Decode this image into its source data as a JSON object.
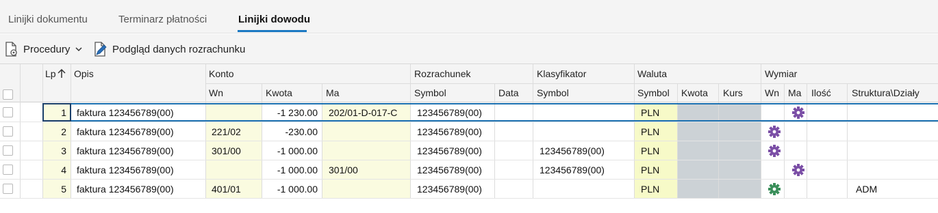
{
  "tabs": [
    {
      "label": "Linijki dokumentu"
    },
    {
      "label": "Terminarz płatności"
    },
    {
      "label": "Linijki dowodu"
    }
  ],
  "toolbar": {
    "procedures_label": "Procedury",
    "preview_label": "Podgląd danych rozrachunku"
  },
  "colors": {
    "accent": "#1a78c2",
    "gear_purple": "#7b4fa6",
    "gear_green": "#3a8f5a",
    "yellow_cell": "#fafbe0",
    "currency_cell": "#f7fac8",
    "grey_cell": "#ccd2d6"
  },
  "grid": {
    "headers_top": {
      "lp": "Lp",
      "opis": "Opis",
      "konto": "Konto",
      "rozrachunek": "Rozrachunek",
      "klasyfikator": "Klasyfikator",
      "waluta": "Waluta",
      "wymiar": "Wymiar"
    },
    "headers_sub": {
      "wn": "Wn",
      "kwota": "Kwota",
      "ma": "Ma",
      "symbol": "Symbol",
      "data": "Data",
      "klas_symbol": "Symbol",
      "wal_symbol": "Symbol",
      "wal_kwota": "Kwota",
      "kurs": "Kurs",
      "wym_wn": "Wn",
      "wym_ma": "Ma",
      "ilosc": "Ilość",
      "struktura": "Struktura\\Działy"
    },
    "sort_icon": "arrow-up-icon",
    "rows": [
      {
        "lp": "1",
        "opis": "faktura  123456789(00)",
        "wn": "",
        "kwota": "-1 230.00",
        "ma": "202/01-D-017-C",
        "symbol": "123456789(00)",
        "data": "",
        "klasyfikator": "",
        "waluta": "PLN",
        "wymiar_gear": "ma",
        "gear_color": "purple",
        "struktura": ""
      },
      {
        "lp": "2",
        "opis": "faktura  123456789(00)",
        "wn": "221/02",
        "kwota": "-230.00",
        "ma": "",
        "symbol": "123456789(00)",
        "data": "",
        "klasyfikator": "",
        "waluta": "PLN",
        "wymiar_gear": "wn",
        "gear_color": "purple",
        "struktura": ""
      },
      {
        "lp": "3",
        "opis": "faktura  123456789(00)",
        "wn": "301/00",
        "kwota": "-1 000.00",
        "ma": "",
        "symbol": "123456789(00)",
        "data": "",
        "klasyfikator": "123456789(00)",
        "waluta": "PLN",
        "wymiar_gear": "wn",
        "gear_color": "purple",
        "struktura": ""
      },
      {
        "lp": "4",
        "opis": "faktura  123456789(00)",
        "wn": "",
        "kwota": "-1 000.00",
        "ma": "301/00",
        "symbol": "123456789(00)",
        "data": "",
        "klasyfikator": "123456789(00)",
        "waluta": "PLN",
        "wymiar_gear": "ma",
        "gear_color": "purple",
        "struktura": ""
      },
      {
        "lp": "5",
        "opis": "faktura  123456789(00)",
        "wn": "401/01",
        "kwota": "-1 000.00",
        "ma": "",
        "symbol": "123456789(00)",
        "data": "",
        "klasyfikator": "",
        "waluta": "PLN",
        "wymiar_gear": "wn",
        "gear_color": "green",
        "struktura": "ADM"
      }
    ]
  }
}
